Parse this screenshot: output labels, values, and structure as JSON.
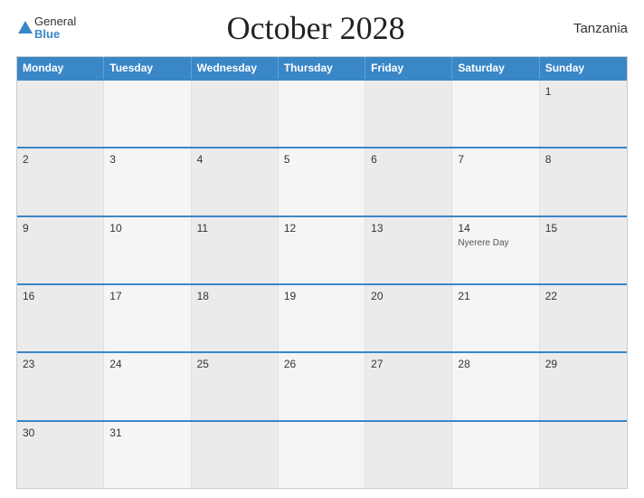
{
  "header": {
    "title": "October 2028",
    "country": "Tanzania",
    "logo": {
      "general": "General",
      "blue": "Blue"
    }
  },
  "weekdays": [
    "Monday",
    "Tuesday",
    "Wednesday",
    "Thursday",
    "Friday",
    "Saturday",
    "Sunday"
  ],
  "weeks": [
    [
      {
        "num": "",
        "event": ""
      },
      {
        "num": "",
        "event": ""
      },
      {
        "num": "",
        "event": ""
      },
      {
        "num": "",
        "event": ""
      },
      {
        "num": "",
        "event": ""
      },
      {
        "num": "",
        "event": ""
      },
      {
        "num": "1",
        "event": ""
      }
    ],
    [
      {
        "num": "2",
        "event": ""
      },
      {
        "num": "3",
        "event": ""
      },
      {
        "num": "4",
        "event": ""
      },
      {
        "num": "5",
        "event": ""
      },
      {
        "num": "6",
        "event": ""
      },
      {
        "num": "7",
        "event": ""
      },
      {
        "num": "8",
        "event": ""
      }
    ],
    [
      {
        "num": "9",
        "event": ""
      },
      {
        "num": "10",
        "event": ""
      },
      {
        "num": "11",
        "event": ""
      },
      {
        "num": "12",
        "event": ""
      },
      {
        "num": "13",
        "event": ""
      },
      {
        "num": "14",
        "event": "Nyerere Day"
      },
      {
        "num": "15",
        "event": ""
      }
    ],
    [
      {
        "num": "16",
        "event": ""
      },
      {
        "num": "17",
        "event": ""
      },
      {
        "num": "18",
        "event": ""
      },
      {
        "num": "19",
        "event": ""
      },
      {
        "num": "20",
        "event": ""
      },
      {
        "num": "21",
        "event": ""
      },
      {
        "num": "22",
        "event": ""
      }
    ],
    [
      {
        "num": "23",
        "event": ""
      },
      {
        "num": "24",
        "event": ""
      },
      {
        "num": "25",
        "event": ""
      },
      {
        "num": "26",
        "event": ""
      },
      {
        "num": "27",
        "event": ""
      },
      {
        "num": "28",
        "event": ""
      },
      {
        "num": "29",
        "event": ""
      }
    ],
    [
      {
        "num": "30",
        "event": ""
      },
      {
        "num": "31",
        "event": ""
      },
      {
        "num": "",
        "event": ""
      },
      {
        "num": "",
        "event": ""
      },
      {
        "num": "",
        "event": ""
      },
      {
        "num": "",
        "event": ""
      },
      {
        "num": "",
        "event": ""
      }
    ]
  ]
}
